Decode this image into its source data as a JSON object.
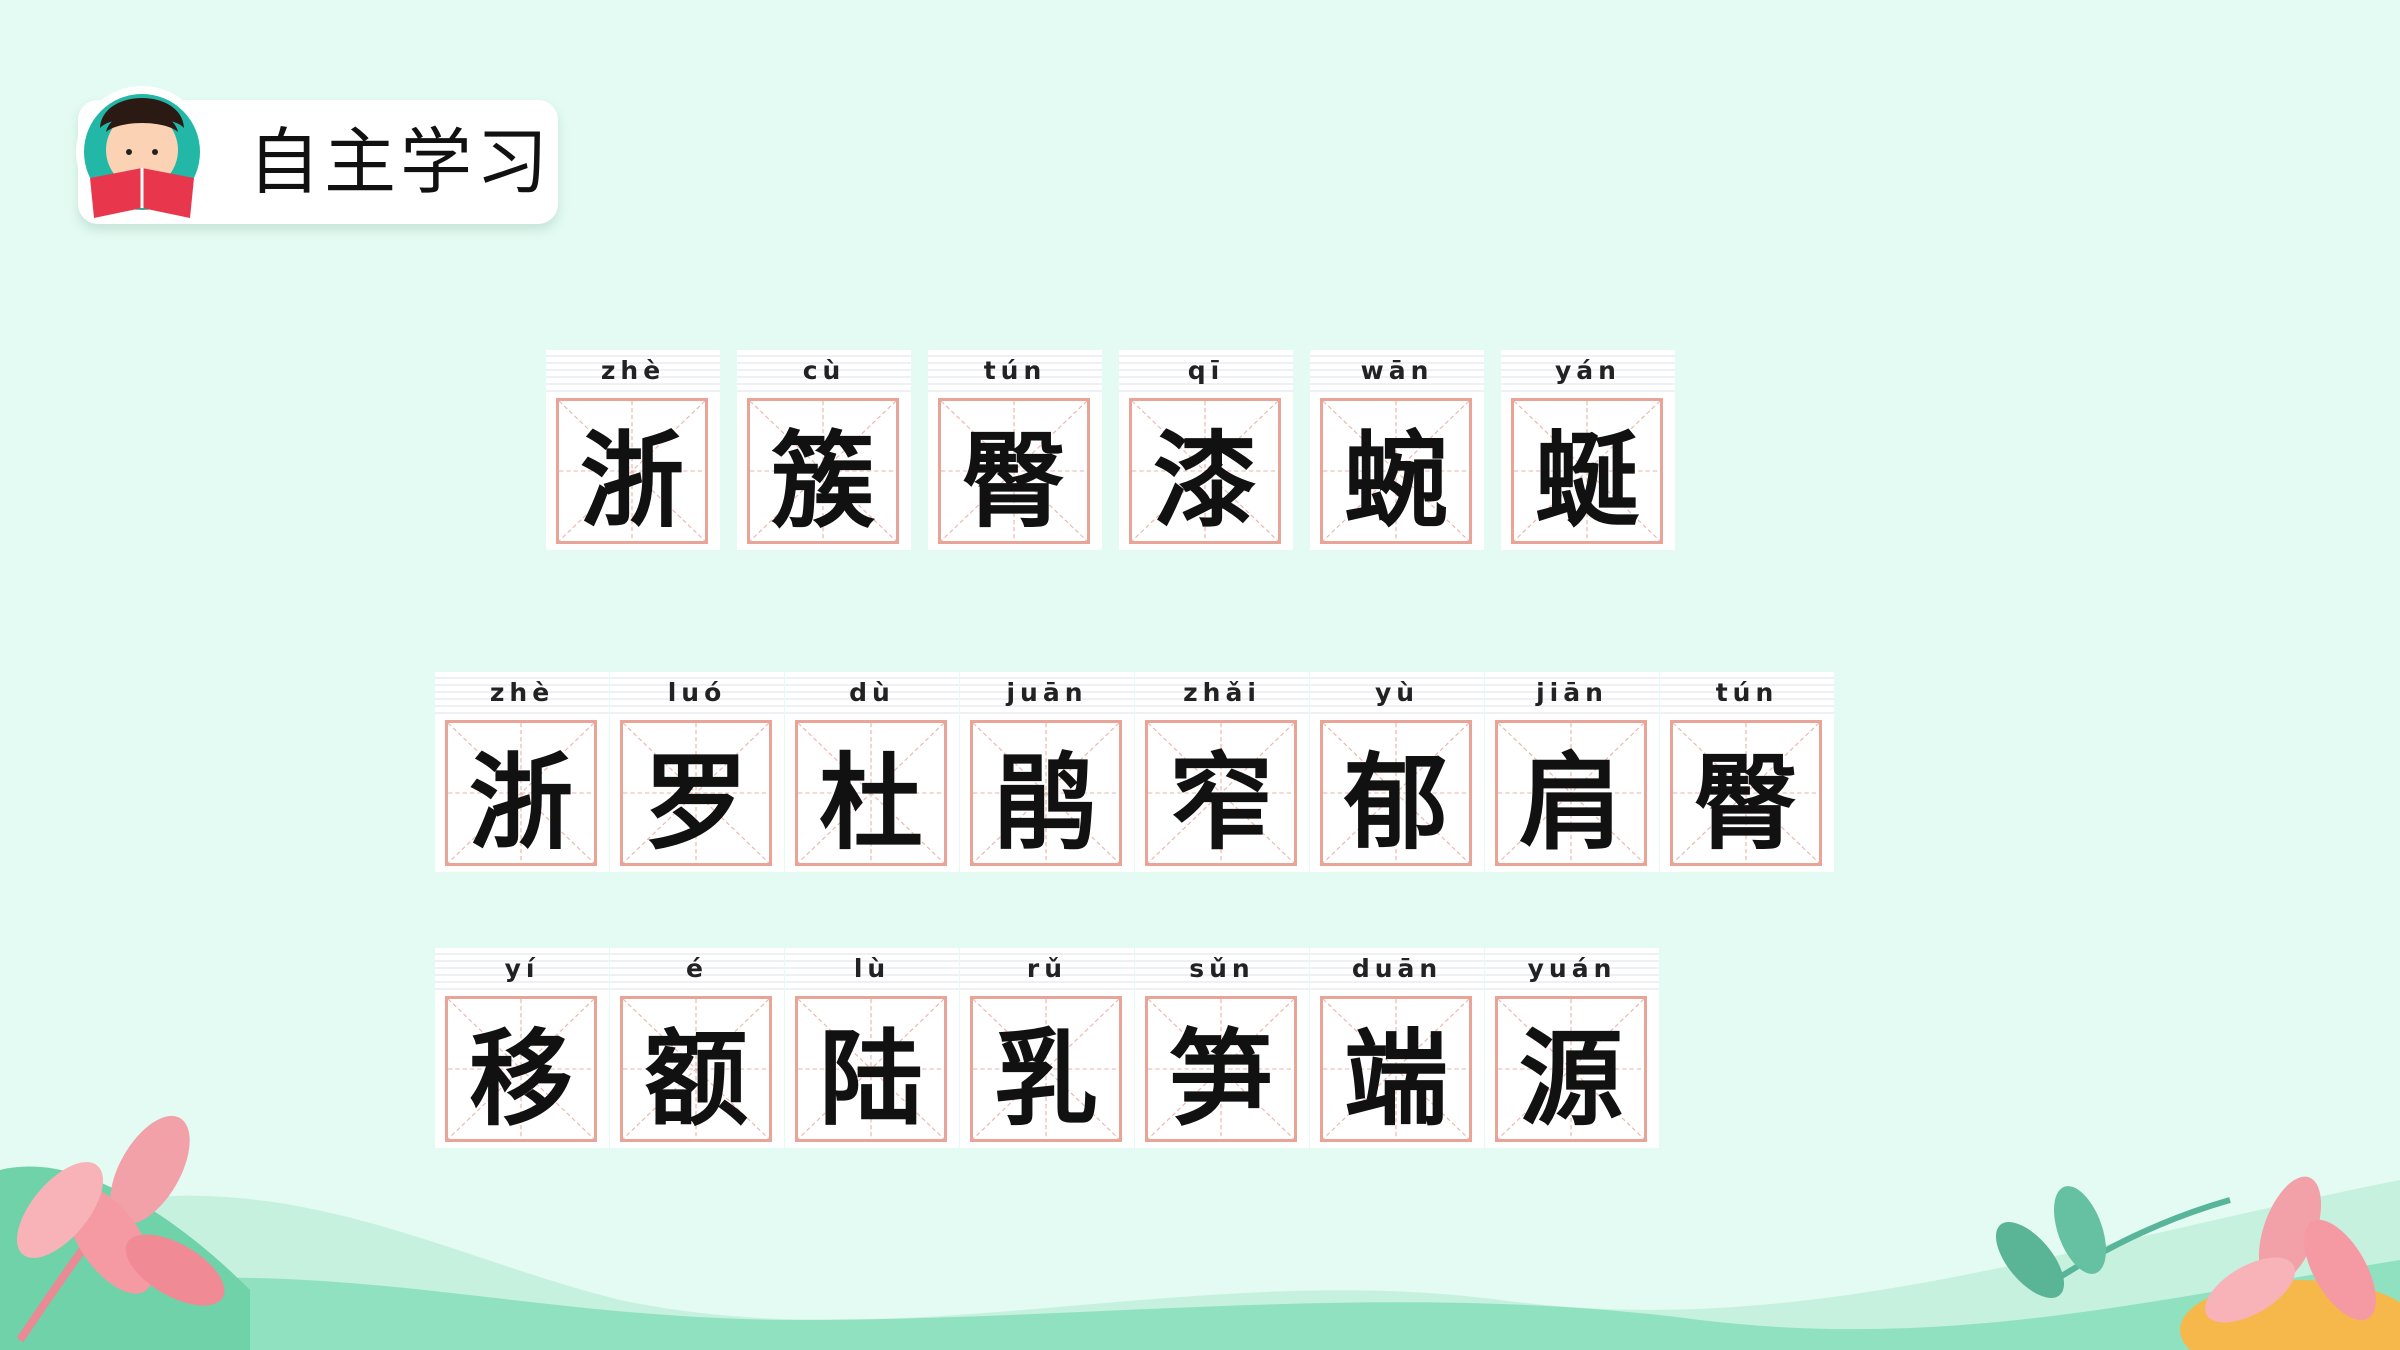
{
  "header": {
    "title": "自主学习"
  },
  "rows": [
    [
      {
        "pinyin": "zhè",
        "char": "浙"
      },
      {
        "pinyin": "cù",
        "char": "簇"
      },
      {
        "pinyin": "tún",
        "char": "臀"
      },
      {
        "pinyin": "qī",
        "char": "漆"
      },
      {
        "pinyin": "wān",
        "char": "蜿"
      },
      {
        "pinyin": "yán",
        "char": "蜒"
      }
    ],
    [
      {
        "pinyin": "zhè",
        "char": "浙"
      },
      {
        "pinyin": "luó",
        "char": "罗"
      },
      {
        "pinyin": "dù",
        "char": "杜"
      },
      {
        "pinyin": "juān",
        "char": "鹃"
      },
      {
        "pinyin": "zhǎi",
        "char": "窄"
      },
      {
        "pinyin": "yù",
        "char": "郁"
      },
      {
        "pinyin": "jiān",
        "char": "肩"
      },
      {
        "pinyin": "tún",
        "char": "臀"
      }
    ],
    [
      {
        "pinyin": "yí",
        "char": "移"
      },
      {
        "pinyin": "é",
        "char": "额"
      },
      {
        "pinyin": "lù",
        "char": "陆"
      },
      {
        "pinyin": "rǔ",
        "char": "乳"
      },
      {
        "pinyin": "sǔn",
        "char": "笋"
      },
      {
        "pinyin": "duān",
        "char": "端"
      },
      {
        "pinyin": "yuán",
        "char": "源"
      }
    ]
  ],
  "colors": {
    "background": "#e3fbf2",
    "grid": "#e7a497",
    "wave": "#7fdbb8",
    "leaf": "#f2a1a8"
  }
}
